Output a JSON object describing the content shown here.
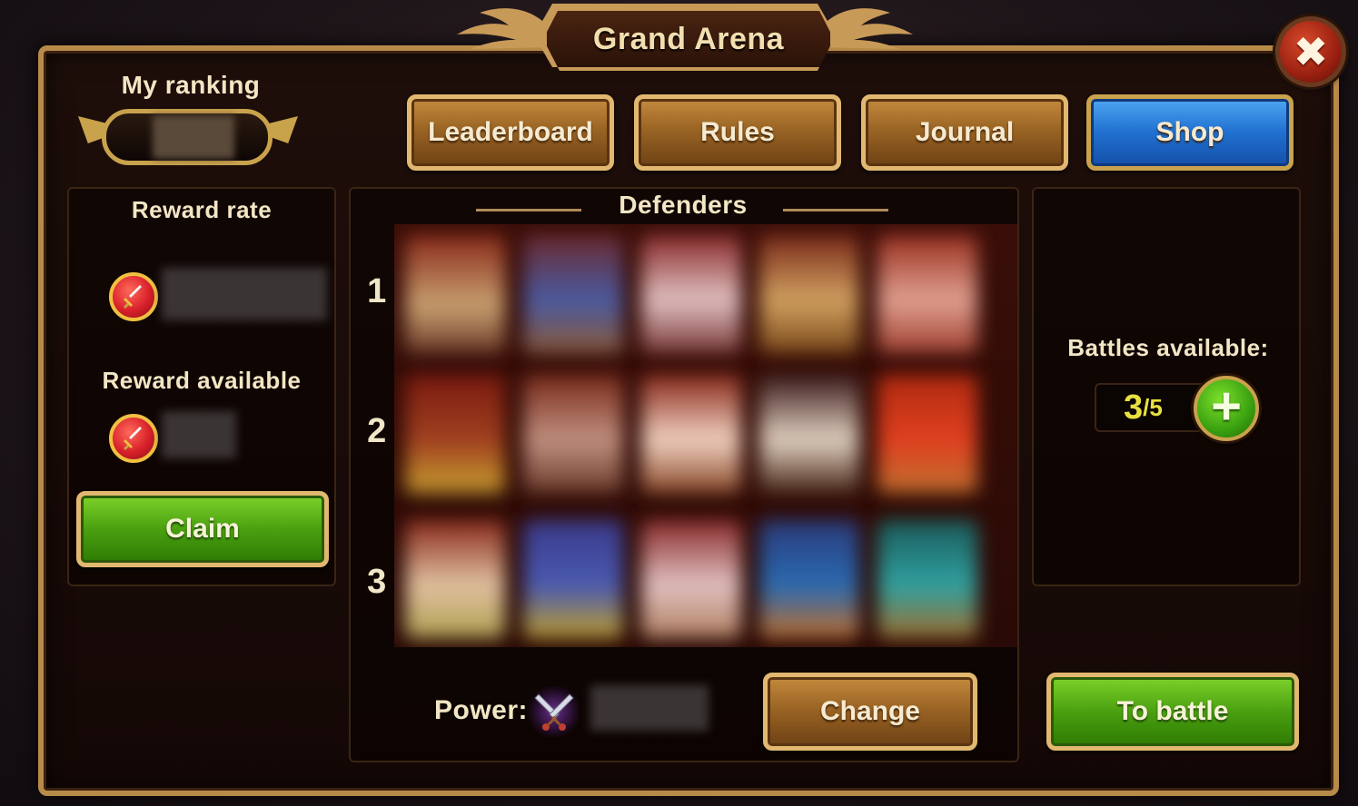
{
  "title": "Grand Arena",
  "close_icon": "close-icon",
  "ranking": {
    "label": "My ranking"
  },
  "tabs": [
    {
      "label": "Leaderboard"
    },
    {
      "label": "Rules"
    },
    {
      "label": "Journal"
    },
    {
      "label": "Shop"
    }
  ],
  "rewards": {
    "rate_label": "Reward rate",
    "available_label": "Reward available",
    "claim_label": "Claim",
    "coin_icon": "sword-coin-icon"
  },
  "defenders": {
    "title": "Defenders",
    "rows": [
      "1",
      "2",
      "3"
    ],
    "power_label": "Power:",
    "power_icon": "crossed-swords-icon",
    "change_label": "Change"
  },
  "battles": {
    "label": "Battles available:",
    "current": "3",
    "separator": "/",
    "max": "5",
    "add_icon": "plus-icon",
    "to_battle_label": "To battle"
  },
  "colors": {
    "gold_frame": "#b88a4a",
    "shop_blue": "#2070d0",
    "action_green": "#4aa010",
    "counter_yellow": "#e8e040",
    "close_red": "#9a2010"
  }
}
